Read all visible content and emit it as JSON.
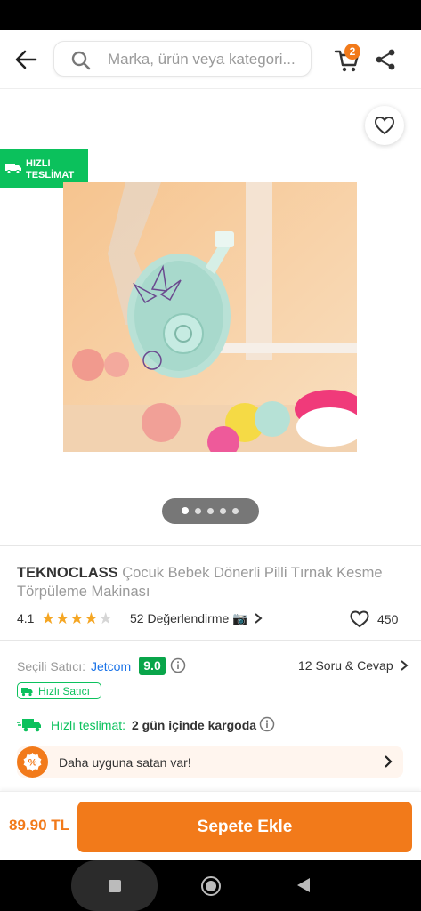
{
  "header": {
    "search_placeholder": "Marka, ürün veya kategori...",
    "cart_count": "2"
  },
  "product": {
    "badge_line1": "HIZLI",
    "badge_line2": "TESLİMAT",
    "image_alt": "Manicure fashion",
    "image_count": 5,
    "active_image_index": 0,
    "brand": "TEKNOCLASS",
    "name": "Çocuk Bebek Dönerli Pilli Tırnak Kesme Törpüleme Makinası",
    "rating": "4.1",
    "rating_value": 4.1,
    "reviews": "52 Değerlendirme 📷",
    "likes": "450"
  },
  "seller": {
    "label": "Seçili Satıcı:",
    "name": "Jetcom",
    "score": "9.0",
    "qa": "12 Soru & Cevap",
    "fast_seller": "Hızlı Satıcı"
  },
  "delivery": {
    "label": "Hızlı teslimat:",
    "value": "2 gün içinde kargoda"
  },
  "cheaper": {
    "text": "Daha uyguna satan var!"
  },
  "checkout": {
    "price": "89.90 TL",
    "button": "Sepete Ekle"
  },
  "colors": {
    "accent": "#f27a1a",
    "green": "#0bc15c",
    "link": "#1a73e8"
  }
}
